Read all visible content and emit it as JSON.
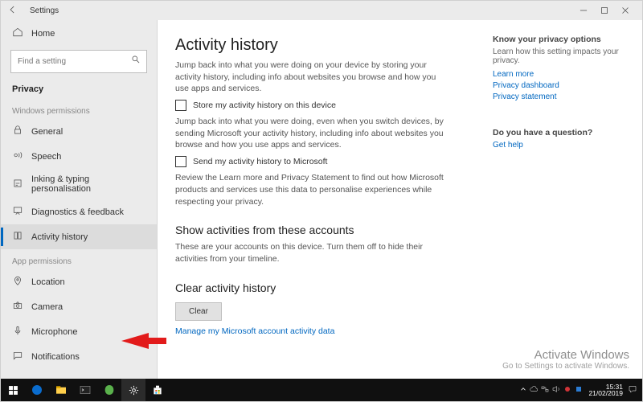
{
  "window": {
    "title": "Settings"
  },
  "sidebar": {
    "home": "Home",
    "search_placeholder": "Find a setting",
    "crumb": "Privacy",
    "sec_win": "Windows permissions",
    "sec_app": "App permissions",
    "win_items": [
      {
        "label": "General"
      },
      {
        "label": "Speech"
      },
      {
        "label": "Inking & typing personalisation"
      },
      {
        "label": "Diagnostics & feedback"
      },
      {
        "label": "Activity history"
      }
    ],
    "app_items": [
      {
        "label": "Location"
      },
      {
        "label": "Camera"
      },
      {
        "label": "Microphone"
      },
      {
        "label": "Notifications"
      }
    ]
  },
  "main": {
    "title": "Activity history",
    "p1": "Jump back into what you were doing on your device by storing your activity history, including info about websites you browse and how you use apps and services.",
    "cb1": "Store my activity history on this device",
    "p2": "Jump back into what you were doing, even when you switch devices, by sending Microsoft your activity history, including info about websites you browse and how you use apps and services.",
    "cb2": "Send my activity history to Microsoft",
    "p3": "Review the Learn more and Privacy Statement to find out how Microsoft products and services use this data to personalise experiences while respecting your privacy.",
    "accounts_h": "Show activities from these accounts",
    "accounts_p": "These are your accounts on this device. Turn them off to hide their activities from your timeline.",
    "clear_h": "Clear activity history",
    "clear_btn": "Clear",
    "manage_link": "Manage my Microsoft account activity data"
  },
  "aside": {
    "title": "Know your privacy options",
    "sub": "Learn how this setting impacts your privacy.",
    "links": [
      "Learn more",
      "Privacy dashboard",
      "Privacy statement"
    ],
    "q_title": "Do you have a question?",
    "q_link": "Get help"
  },
  "watermark": {
    "l1": "Activate Windows",
    "l2": "Go to Settings to activate Windows."
  },
  "tray": {
    "time": "15:31",
    "date": "21/02/2019"
  }
}
